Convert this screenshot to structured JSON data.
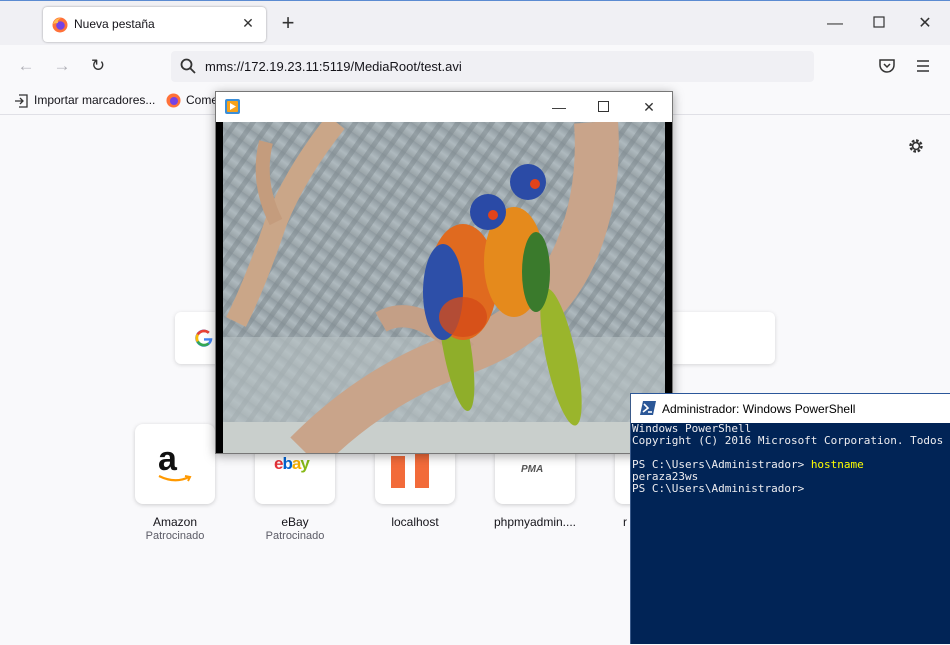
{
  "browser": {
    "tab_title": "Nueva pestaña",
    "address": "mms://172.19.23.11:5119/MediaRoot/test.avi",
    "bookmarks": [
      {
        "label": "Importar marcadores..."
      },
      {
        "label": "Come"
      }
    ],
    "shortcuts": [
      {
        "name": "Amazon",
        "sponsor": "Patrocinado",
        "logo": "amazon"
      },
      {
        "name": "eBay",
        "sponsor": "Patrocinado",
        "logo": "ebay"
      },
      {
        "name": "localhost",
        "sponsor": "",
        "logo": ""
      },
      {
        "name": "phpmyadmin....",
        "sponsor": "",
        "logo": "PMA"
      },
      {
        "name": "r",
        "sponsor": "",
        "logo": ""
      }
    ],
    "icons": [
      "firefox-icon",
      "close-icon",
      "plus-icon",
      "minimize-icon",
      "maximize-icon",
      "back-icon",
      "forward-icon",
      "reload-icon",
      "search-icon",
      "pocket-icon",
      "menu-icon",
      "import-icon",
      "gear-icon",
      "google-icon"
    ]
  },
  "player": {
    "title": "",
    "content": "video of two rainbow lorikeets on a branch"
  },
  "powershell": {
    "title": "Administrador: Windows PowerShell",
    "lines": [
      {
        "text": "Windows PowerShell"
      },
      {
        "text": "Copyright (C) 2016 Microsoft Corporation. Todos"
      },
      {
        "text": ""
      },
      {
        "prompt": "PS C:\\Users\\Administrador> ",
        "cmd": "hostname"
      },
      {
        "text": "peraza23ws"
      },
      {
        "prompt": "PS C:\\Users\\Administrador> ",
        "cmd": ""
      }
    ],
    "colors": {
      "background": "#012456",
      "text": "#eeedf0",
      "command": "#ffff00"
    }
  }
}
